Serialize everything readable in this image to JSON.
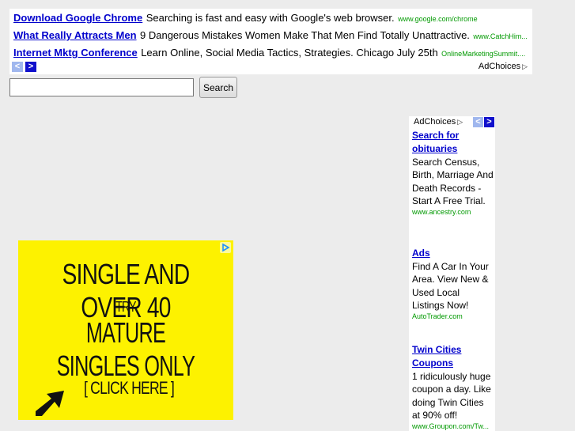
{
  "top_ads": {
    "items": [
      {
        "title": "Download Google Chrome",
        "desc": "Searching is fast and easy with Google's web browser.",
        "url": "www.google.com/chrome"
      },
      {
        "title": "What Really Attracts Men",
        "desc": "9 Dangerous Mistakes Women Make That Men Find Totally Unattractive.",
        "url": "www.CatchHim..."
      },
      {
        "title": "Internet Mktg Conference",
        "desc": "Learn Online, Social Media Tactics, Strategies. Chicago July 25th",
        "url": "OnlineMarketingSummit...."
      }
    ],
    "prev_glyph": "<",
    "next_glyph": ">",
    "adchoices_label": "AdChoices",
    "adchoices_glyph": "▷"
  },
  "search": {
    "value": "",
    "button_label": "Search"
  },
  "side_ad": {
    "adchoices_label": "AdChoices",
    "adchoices_glyph": "▷",
    "prev_glyph": "<",
    "next_glyph": ">",
    "items": [
      {
        "title": "Search for obituaries",
        "desc": "Search Census, Birth, Marriage And Death Records - Start A Free Trial.",
        "url": "www.ancestry.com"
      },
      {
        "title": "Ads",
        "desc": "Find A Car In Your Area. View New & Used Local Listings Now!",
        "url": "AutoTrader.com"
      },
      {
        "title": "Twin Cities Coupons",
        "desc": "1 ridiculously huge coupon a day. Like doing Twin Cities at 90% off!",
        "url": "www.Groupon.com/Tw..."
      }
    ]
  },
  "banner": {
    "line1": "SINGLE AND OVER 40",
    "line2": "TRY",
    "line3": "MATURE SINGLES ONLY",
    "cta": "[ CLICK HERE ]",
    "colors": {
      "background": "#fdf200",
      "text": "#111111"
    }
  },
  "colors": {
    "page_bg": "#ececec",
    "ad_title": "#0000cc",
    "ad_url": "#009900"
  }
}
